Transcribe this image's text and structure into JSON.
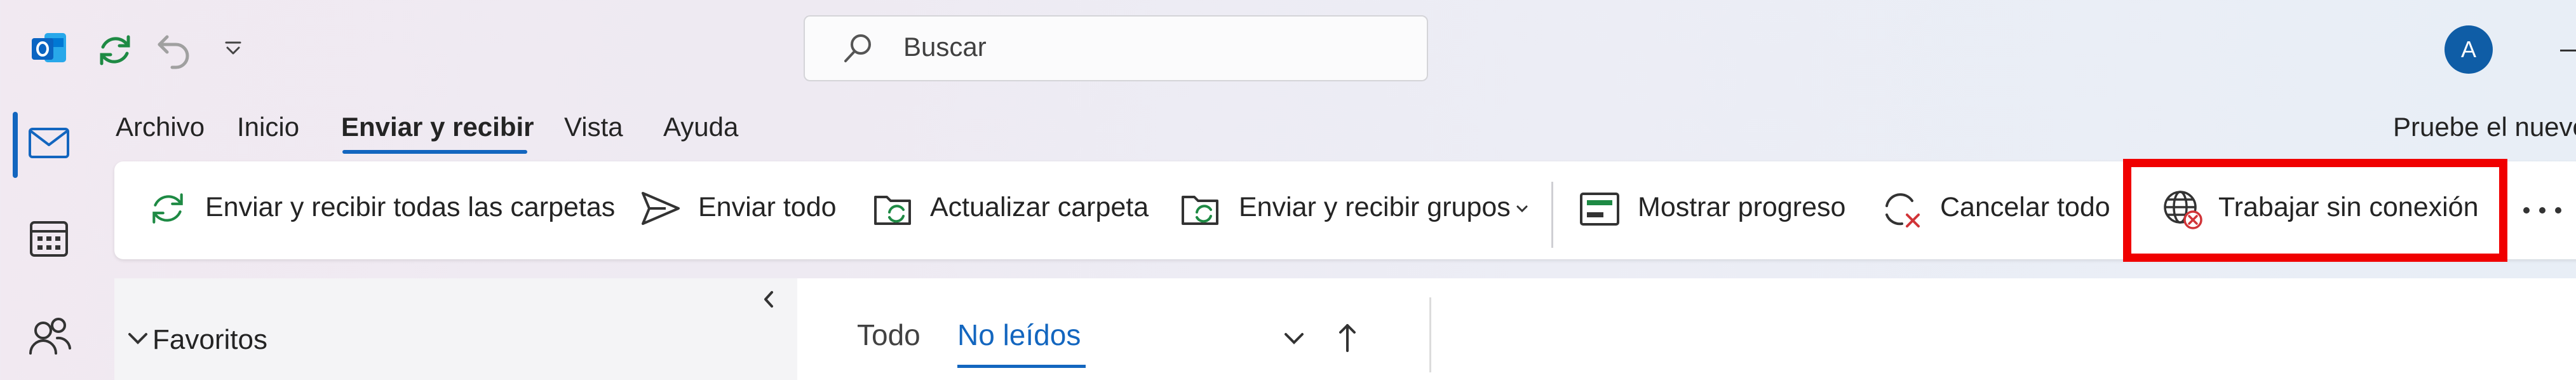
{
  "app": {
    "name": "Outlook",
    "accent": "#1366bf",
    "highlight_color": "#f00000"
  },
  "titlebar": {
    "search_placeholder": "Buscar",
    "avatar_initial": "A",
    "icons": [
      "outlook-logo-icon",
      "sync-icon",
      "undo-icon",
      "customize-toolbar-icon",
      "search-icon"
    ]
  },
  "rail": {
    "icons": [
      "mail-icon",
      "calendar-icon",
      "people-icon"
    ]
  },
  "menu": {
    "tabs": [
      "Archivo",
      "Inicio",
      "Enviar y recibir",
      "Vista",
      "Ayuda"
    ],
    "active_tab": "Enviar y recibir",
    "promo": "Pruebe el nuevo"
  },
  "ribbon": {
    "buttons": [
      {
        "label": "Enviar y recibir todas las carpetas",
        "icon": "sync-icon"
      },
      {
        "label": "Enviar todo",
        "icon": "send-icon"
      },
      {
        "label": "Actualizar carpeta",
        "icon": "folder-sync-icon"
      },
      {
        "label": "Enviar y recibir grupos",
        "icon": "folder-sync-icon",
        "has_dropdown": true
      },
      {
        "label": "Mostrar progreso",
        "icon": "progress-icon"
      },
      {
        "label": "Cancelar todo",
        "icon": "cancel-sync-icon"
      },
      {
        "label": "Trabajar sin conexión",
        "icon": "globe-offline-icon",
        "highlighted": true
      }
    ],
    "more_icon": "more-options-icon"
  },
  "folders": {
    "favorites_label": "Favoritos"
  },
  "list": {
    "filters": [
      "Todo",
      "No leídos"
    ],
    "active_filter": "No leídos"
  }
}
